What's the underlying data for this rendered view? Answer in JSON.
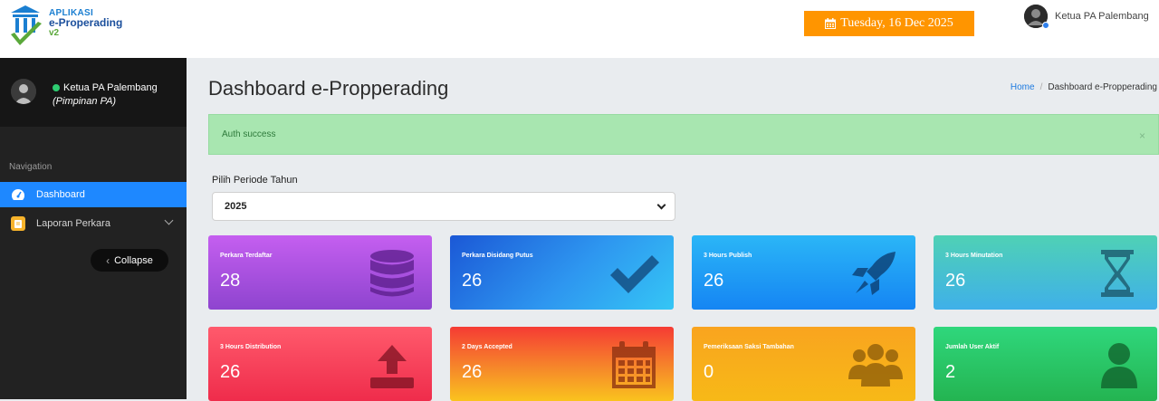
{
  "header": {
    "logo": {
      "line1": "APLIKASI",
      "line2": "e-Properading",
      "line3": "v2"
    },
    "date": "Tuesday, 16 Dec 2025",
    "user_name": "Ketua PA Palembang"
  },
  "sidebar": {
    "user_name": "Ketua PA Palembang",
    "user_role": "(Pimpinan PA)",
    "nav_heading": "Navigation",
    "items": [
      {
        "label": "Dashboard",
        "icon": "dashboard-gauge-icon",
        "active": true
      },
      {
        "label": "Laporan Perkara",
        "icon": "book-icon",
        "active": false
      }
    ],
    "collapse_label": "Collapse"
  },
  "main": {
    "title": "Dashboard e-Propperading",
    "breadcrumb": {
      "home": "Home",
      "separator": "/",
      "current": "Dashboard e-Propperading"
    },
    "alert": {
      "message": "Auth success",
      "close": "×"
    },
    "period": {
      "label": "Pilih Periode Tahun",
      "selected": "2025"
    },
    "cards": [
      {
        "label": "Perkara Terdaftar",
        "value": "28",
        "icon": "database-icon"
      },
      {
        "label": "Perkara Disidang Putus",
        "value": "26",
        "icon": "checkmark-icon"
      },
      {
        "label": "3 Hours Publish",
        "value": "26",
        "icon": "rocket-icon"
      },
      {
        "label": "3 Hours Minutation",
        "value": "26",
        "icon": "hourglass-icon"
      },
      {
        "label": "3 Hours Distribution",
        "value": "26",
        "icon": "upload-icon"
      },
      {
        "label": "2 Days Accepted",
        "value": "26",
        "icon": "calendar-icon"
      },
      {
        "label": "Pemeriksaan Saksi Tambahan",
        "value": "0",
        "icon": "users-icon"
      },
      {
        "label": "Jumlah User Aktif",
        "value": "2",
        "icon": "user-icon"
      }
    ]
  },
  "colors": {
    "accent_blue": "#1e88ff",
    "date_badge": "#ff9500",
    "alert_bg": "#a8e6b0",
    "sidebar_bg": "#222222"
  }
}
